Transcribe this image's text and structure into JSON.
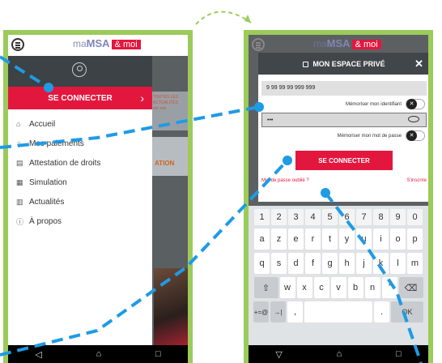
{
  "left_phone": {
    "logo": {
      "ma": "ma",
      "msa": "MSA",
      "moi": "& moi"
    },
    "connect_label": "SE CONNECTER",
    "menu": [
      {
        "icon": "home-icon",
        "glyph": "⌂",
        "label": "Accueil"
      },
      {
        "icon": "payment-icon",
        "glyph": "♨",
        "label": "Mes paiements"
      },
      {
        "icon": "document-icon",
        "glyph": "▤",
        "label": "Attestation de droits"
      },
      {
        "icon": "calculator-icon",
        "glyph": "▦",
        "label": "Simulation"
      },
      {
        "icon": "news-icon",
        "glyph": "▥",
        "label": "Actualités"
      },
      {
        "icon": "info-icon",
        "glyph": "ⓘ",
        "label": "À propos"
      }
    ],
    "bg_card1_text": "TOUTES LES ACTUALITÉS",
    "bg_card1_sub": "ver vos",
    "bg_card2_text": "ATION"
  },
  "right_phone": {
    "logo": {
      "ma": "ma",
      "msa": "MSA",
      "moi": "& moi"
    },
    "modal_title": "MON ESPACE PRIVÉ",
    "close": "✕",
    "id_value": "9 99 99 99 999 999",
    "remember_id": "Mémoriser mon identifiant",
    "password_value": "•••",
    "remember_pw": "Mémoriser mon mot de passe",
    "connect_label": "SE CONNECTER",
    "forgot": "Mot de passe oublié ?",
    "signup": "S'inscrire",
    "keyboard": {
      "row0": [
        "1",
        "2",
        "3",
        "4",
        "5",
        "6",
        "7",
        "8",
        "9",
        "0"
      ],
      "row1": [
        "a",
        "z",
        "e",
        "r",
        "t",
        "y",
        "u",
        "i",
        "o",
        "p"
      ],
      "row2": [
        "q",
        "s",
        "d",
        "f",
        "g",
        "h",
        "j",
        "k",
        "l",
        "m"
      ],
      "row3": [
        "⇧",
        "w",
        "x",
        "c",
        "v",
        "b",
        "n",
        "'",
        "⌫"
      ],
      "row4": [
        "+=@",
        "→|",
        ",",
        "",
        ".",
        "OK"
      ]
    }
  },
  "navbar": {
    "back": "◁",
    "home": "⌂",
    "recent": "□"
  }
}
